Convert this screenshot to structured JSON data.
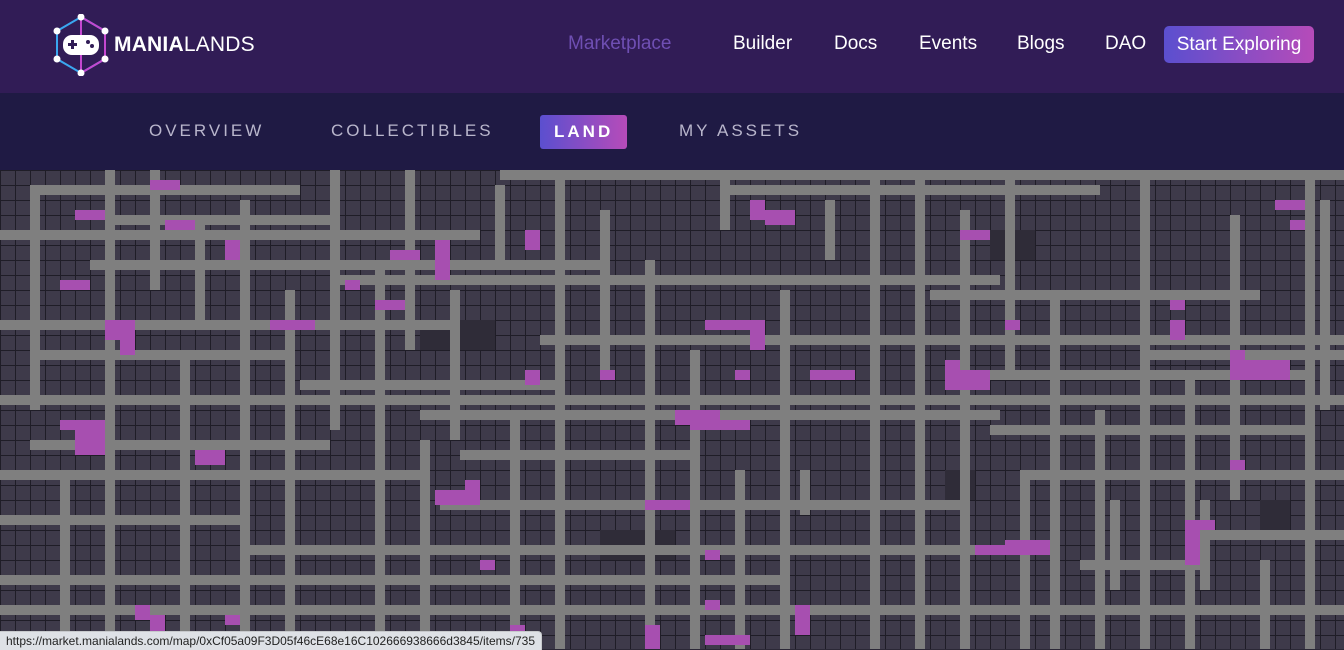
{
  "brand": {
    "name_bold": "MANIA",
    "name_thin": "LANDS"
  },
  "nav": {
    "items": [
      {
        "label": "Marketplace",
        "active": true
      },
      {
        "label": "Builder"
      },
      {
        "label": "Docs"
      },
      {
        "label": "Events"
      },
      {
        "label": "Blogs"
      },
      {
        "label": "DAO"
      }
    ],
    "cta_label": "Start Exploring"
  },
  "tabs": [
    {
      "label": "OVERVIEW"
    },
    {
      "label": "COLLECTIBLES"
    },
    {
      "label": "LAND",
      "active": true
    },
    {
      "label": "MY ASSETS"
    }
  ],
  "map": {
    "colors": {
      "parcel": "#3e3a4a",
      "grid_line": "#1f1d27",
      "road": "#7f7f7f",
      "owned": "#a74fb0",
      "plaza": "#2f2c38"
    }
  },
  "status_bar": {
    "url": "https://market.manialands.com/map/0xCf05a09F3D05f46cE68e16C102666938666d3845/items/735"
  },
  "icons": {
    "logo": "gamepad-hexagon-icon"
  }
}
